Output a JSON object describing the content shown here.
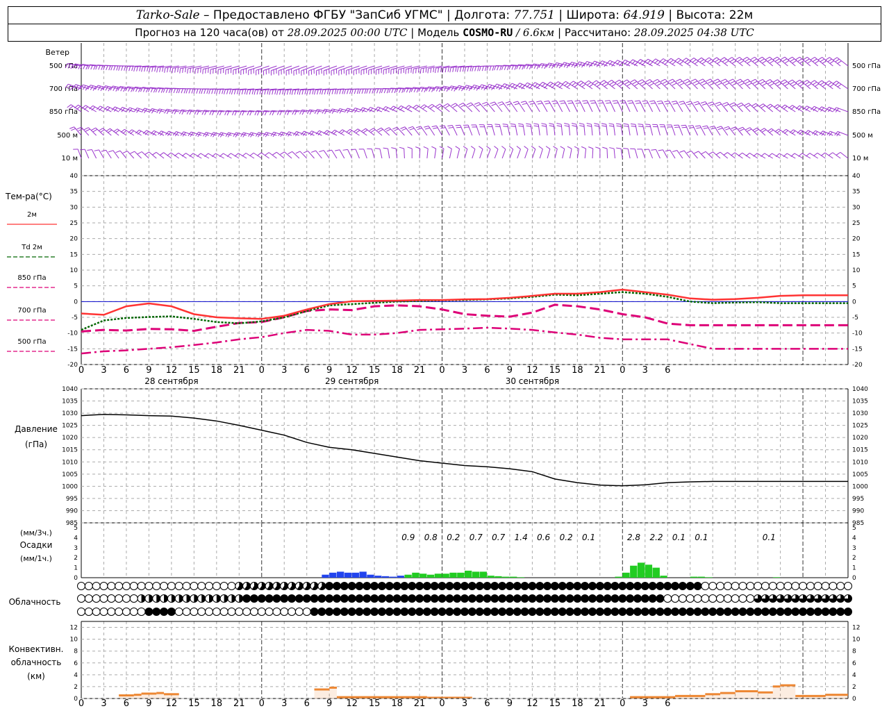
{
  "header": {
    "station": "Tarko-Sale",
    "provider": "– Предоставлено ФГБУ \"ЗапСиб УГМС\"",
    "lon_label": "Долгота:",
    "lon": "77.751",
    "lat_label": "Широта:",
    "lat": "64.919",
    "alt_label": "Высота:",
    "alt": "22м",
    "forecast_prefix": "Прогноз на 120 часа(ов) от",
    "forecast_start": "28.09.2025 00:00 UTC",
    "model_label": "Модель",
    "model_name": "COSMO-RU",
    "model_res": "/ 6.6км",
    "calc_label": "Рассчитано:",
    "calc_time": "28.09.2025 04:38 UTC",
    "sep": "|"
  },
  "colors": {
    "wind": "#9933cc",
    "t2m": "#ff3333",
    "td2m": "#006600",
    "t850": "#dd0077",
    "t700": "#dd0077",
    "t500": "#dd0077",
    "precip_rain": "#2244ee",
    "precip_green": "#22cc22",
    "convective": "#ee8833",
    "zero_line": "#0000cc"
  },
  "time_axis": {
    "hours": [
      "0",
      "3",
      "6",
      "9",
      "12",
      "15",
      "18",
      "21",
      "0",
      "3",
      "6",
      "9",
      "12",
      "15",
      "18",
      "21",
      "0",
      "3",
      "6",
      "9",
      "12",
      "15",
      "18",
      "21",
      "0",
      "3",
      "6"
    ],
    "days": [
      "28 сентября",
      "29 сентября",
      "30 сентября"
    ]
  },
  "wind_panel": {
    "title": "Ветер",
    "levels": [
      "500 гПа",
      "700 гПа",
      "850 гПа",
      "500 м",
      "10 м"
    ],
    "levels_right": [
      "500 гПа",
      "700 гПа",
      "850 гПа",
      "500 м",
      "10 м"
    ]
  },
  "temp_panel": {
    "title": "Тем-ра(°С)",
    "legend": [
      {
        "key": "t2m",
        "label": "2м",
        "style": "solid"
      },
      {
        "key": "td2m",
        "label_prefix": "Td",
        "label": "2м",
        "style": "dotted"
      },
      {
        "key": "t850",
        "label": "850 гПа",
        "style": "solid"
      },
      {
        "key": "t700",
        "label": "700 гПа",
        "style": "dashed"
      },
      {
        "key": "t500",
        "label": "500 гПа",
        "style": "dashdot"
      }
    ]
  },
  "pressure_panel": {
    "title": "Давление",
    "unit": "(гПа)"
  },
  "precip_panel": {
    "unit1": "(мм/3ч.)",
    "title": "Осадки",
    "unit2": "(мм/1ч.)",
    "sums": [
      {
        "h": 45,
        "v": "0.9"
      },
      {
        "h": 48,
        "v": "0.8"
      },
      {
        "h": 51,
        "v": "0.2"
      },
      {
        "h": 54,
        "v": "0.7"
      },
      {
        "h": 57,
        "v": "0.7"
      },
      {
        "h": 60,
        "v": "1.4"
      },
      {
        "h": 63,
        "v": "0.6"
      },
      {
        "h": 66,
        "v": "0.2"
      },
      {
        "h": 69,
        "v": "0.1"
      },
      {
        "h": 75,
        "v": "2.8"
      },
      {
        "h": 78,
        "v": "2.2"
      },
      {
        "h": 81,
        "v": "0.1"
      },
      {
        "h": 84,
        "v": "0.1"
      },
      {
        "h": 93,
        "v": "0.1"
      }
    ]
  },
  "cloud_panel": {
    "title": "Облачность"
  },
  "conv_panel": {
    "title1": "Конвективн.",
    "title2": "облачность",
    "unit": "(км)"
  },
  "chart_data": [
    {
      "type": "line",
      "title": "Тем-ра(°С)",
      "x_unit": "hours from 28.09.2025 00:00 UTC",
      "x": [
        0,
        3,
        6,
        9,
        12,
        15,
        18,
        21,
        24,
        27,
        30,
        33,
        36,
        39,
        42,
        45,
        48,
        51,
        54,
        57,
        60,
        63,
        66,
        69,
        72,
        75,
        78,
        81,
        84,
        87,
        90,
        93,
        96,
        99,
        102
      ],
      "ylim": [
        -20,
        40
      ],
      "grid": true,
      "series": [
        {
          "name": "2м",
          "key": "t2m",
          "values": [
            -3.8,
            -4.2,
            -1.5,
            -0.6,
            -1.5,
            -4.0,
            -5.0,
            -5.3,
            -5.5,
            -4.5,
            -2.5,
            -0.8,
            0.1,
            0.2,
            0.3,
            0.5,
            0.5,
            0.7,
            0.8,
            1.2,
            1.8,
            2.5,
            2.5,
            3.0,
            3.8,
            3.0,
            2.2,
            1.0,
            0.6,
            0.8,
            1.2,
            1.8,
            2.0,
            2.0,
            2.0
          ]
        },
        {
          "name": "Td 2м",
          "key": "td2m",
          "values": [
            -9.0,
            -6.0,
            -5.2,
            -4.9,
            -4.7,
            -5.5,
            -6.5,
            -6.9,
            -6.3,
            -5.0,
            -3.0,
            -1.2,
            -0.8,
            -0.4,
            0.0,
            0.2,
            0.4,
            0.5,
            0.7,
            1.0,
            1.5,
            2.2,
            2.0,
            2.5,
            3.0,
            2.5,
            1.5,
            0.0,
            -0.5,
            -0.3,
            -0.2,
            -0.5,
            -0.5,
            -0.5,
            -0.5
          ]
        },
        {
          "name": "850 гПа",
          "key": "t850",
          "values": [
            -9.5,
            -9.0,
            -9.2,
            -8.7,
            -8.8,
            -9.3,
            -8.0,
            -6.8,
            -6.5,
            -5.0,
            -3.0,
            -2.5,
            -2.7,
            -1.5,
            -1.2,
            -1.5,
            -2.5,
            -4.0,
            -4.5,
            -4.8,
            -3.5,
            -1.0,
            -1.5,
            -2.5,
            -4.0,
            -5.0,
            -7.0,
            -7.5,
            -7.5,
            -7.5,
            -7.5,
            -7.5,
            -7.5,
            -7.5,
            -7.5
          ]
        },
        {
          "name": "700 гПа",
          "key": "t700",
          "values": [
            -9.5,
            -9.0,
            -9.2,
            -8.7,
            -8.8,
            -9.3,
            -8.0,
            -6.8,
            -6.5,
            -5.0,
            -3.0,
            -2.5,
            -2.7,
            -1.5,
            -1.2,
            -1.5,
            -2.5,
            -4.0,
            -4.5,
            -4.8,
            -3.5,
            -1.0,
            -1.5,
            -2.5,
            -4.0,
            -5.0,
            -7.0,
            -7.5,
            -7.5,
            -7.5,
            -7.5,
            -7.5,
            -7.5,
            -7.5,
            -7.5
          ]
        },
        {
          "name": "500 гПа",
          "key": "t500",
          "values": [
            -16.5,
            -15.8,
            -15.5,
            -15.0,
            -14.5,
            -13.8,
            -13.0,
            -12.0,
            -11.3,
            -10.0,
            -9.0,
            -9.3,
            -10.5,
            -10.5,
            -10.0,
            -9.0,
            -8.8,
            -8.6,
            -8.3,
            -8.6,
            -9.0,
            -9.8,
            -10.5,
            -11.5,
            -12.0,
            -12.0,
            -12.0,
            -13.5,
            -15.0,
            -15.0,
            -15.0,
            -15.0,
            -15.0,
            -15.0,
            -15.0
          ]
        }
      ]
    },
    {
      "type": "line",
      "title": "Давление",
      "ylabel": "(гПа)",
      "x": [
        0,
        3,
        6,
        9,
        12,
        15,
        18,
        21,
        24,
        27,
        30,
        33,
        36,
        39,
        42,
        45,
        48,
        51,
        54,
        57,
        60,
        63,
        66,
        69,
        72,
        75,
        78,
        81,
        84,
        87,
        90,
        93,
        96,
        99,
        102
      ],
      "ylim": [
        985,
        1040
      ],
      "grid": true,
      "series": [
        {
          "name": "Давление",
          "values": [
            1029,
            1029.5,
            1029.3,
            1029,
            1028.8,
            1028,
            1026.8,
            1025,
            1023,
            1021,
            1018,
            1016,
            1015,
            1013.5,
            1012,
            1010.5,
            1009.5,
            1008.5,
            1008,
            1007.2,
            1006,
            1003,
            1001.5,
            1000.5,
            1000.2,
            1000.6,
            1001.5,
            1001.8,
            1002,
            1002,
            1002,
            1002,
            1002,
            1002,
            1002
          ]
        }
      ]
    },
    {
      "type": "bar",
      "title": "Осадки",
      "ylabel": "(мм/1ч.)",
      "ylim": [
        0,
        5
      ],
      "series": [
        {
          "name": "1h",
          "values": [
            {
              "h": 33,
              "v": 0.3
            },
            {
              "h": 34,
              "v": 0.5
            },
            {
              "h": 35,
              "v": 0.6
            },
            {
              "h": 36,
              "v": 0.5
            },
            {
              "h": 37,
              "v": 0.5
            },
            {
              "h": 38,
              "v": 0.6
            },
            {
              "h": 39,
              "v": 0.3
            },
            {
              "h": 40,
              "v": 0.2
            },
            {
              "h": 41,
              "v": 0.15
            },
            {
              "h": 42,
              "v": 0.1
            },
            {
              "h": 43,
              "v": 0.2
            },
            {
              "h": 44,
              "v": 0.3
            },
            {
              "h": 45,
              "v": 0.5
            },
            {
              "h": 46,
              "v": 0.4
            },
            {
              "h": 47,
              "v": 0.3
            },
            {
              "h": 48,
              "v": 0.4
            },
            {
              "h": 49,
              "v": 0.4
            },
            {
              "h": 50,
              "v": 0.5
            },
            {
              "h": 51,
              "v": 0.5
            },
            {
              "h": 52,
              "v": 0.7
            },
            {
              "h": 53,
              "v": 0.6
            },
            {
              "h": 54,
              "v": 0.6
            },
            {
              "h": 55,
              "v": 0.2
            },
            {
              "h": 56,
              "v": 0.15
            },
            {
              "h": 57,
              "v": 0.1
            },
            {
              "h": 58,
              "v": 0.1
            },
            {
              "h": 59,
              "v": 0.05
            },
            {
              "h": 72,
              "v": 0.1
            },
            {
              "h": 73,
              "v": 0.5
            },
            {
              "h": 74,
              "v": 1.2
            },
            {
              "h": 75,
              "v": 1.5
            },
            {
              "h": 76,
              "v": 1.3
            },
            {
              "h": 77,
              "v": 1.0
            },
            {
              "h": 78,
              "v": 0.2
            },
            {
              "h": 82,
              "v": 0.1
            },
            {
              "h": 83,
              "v": 0.1
            },
            {
              "h": 84,
              "v": 0.05
            },
            {
              "h": 93,
              "v": 0.05
            }
          ]
        }
      ]
    },
    {
      "type": "area",
      "title": "Конвективн. облачность",
      "ylabel": "(км)",
      "ylim": [
        0,
        13
      ],
      "series": [
        {
          "name": "tops",
          "values": [
            {
              "h0": 5,
              "h1": 7,
              "v": 0.7
            },
            {
              "h0": 7,
              "h1": 8,
              "v": 0.8
            },
            {
              "h0": 8,
              "h1": 10,
              "v": 1.0
            },
            {
              "h0": 10,
              "h1": 11,
              "v": 1.1
            },
            {
              "h0": 11,
              "h1": 13,
              "v": 0.9
            },
            {
              "h0": 31,
              "h1": 33,
              "v": 1.7
            },
            {
              "h0": 33,
              "h1": 34,
              "v": 2.0
            },
            {
              "h0": 34,
              "h1": 46,
              "v": 0.4
            },
            {
              "h0": 46,
              "h1": 52,
              "v": 0.3
            },
            {
              "h0": 73,
              "h1": 79,
              "v": 0.4
            },
            {
              "h0": 79,
              "h1": 83,
              "v": 0.6
            },
            {
              "h0": 83,
              "h1": 85,
              "v": 0.9
            },
            {
              "h0": 85,
              "h1": 87,
              "v": 1.1
            },
            {
              "h0": 87,
              "h1": 90,
              "v": 1.4
            },
            {
              "h0": 90,
              "h1": 92,
              "v": 1.2
            },
            {
              "h0": 92,
              "h1": 93,
              "v": 2.2
            },
            {
              "h0": 93,
              "h1": 95,
              "v": 2.4
            },
            {
              "h0": 95,
              "h1": 99,
              "v": 0.6
            },
            {
              "h0": 99,
              "h1": 102,
              "v": 0.8
            }
          ]
        }
      ]
    }
  ]
}
